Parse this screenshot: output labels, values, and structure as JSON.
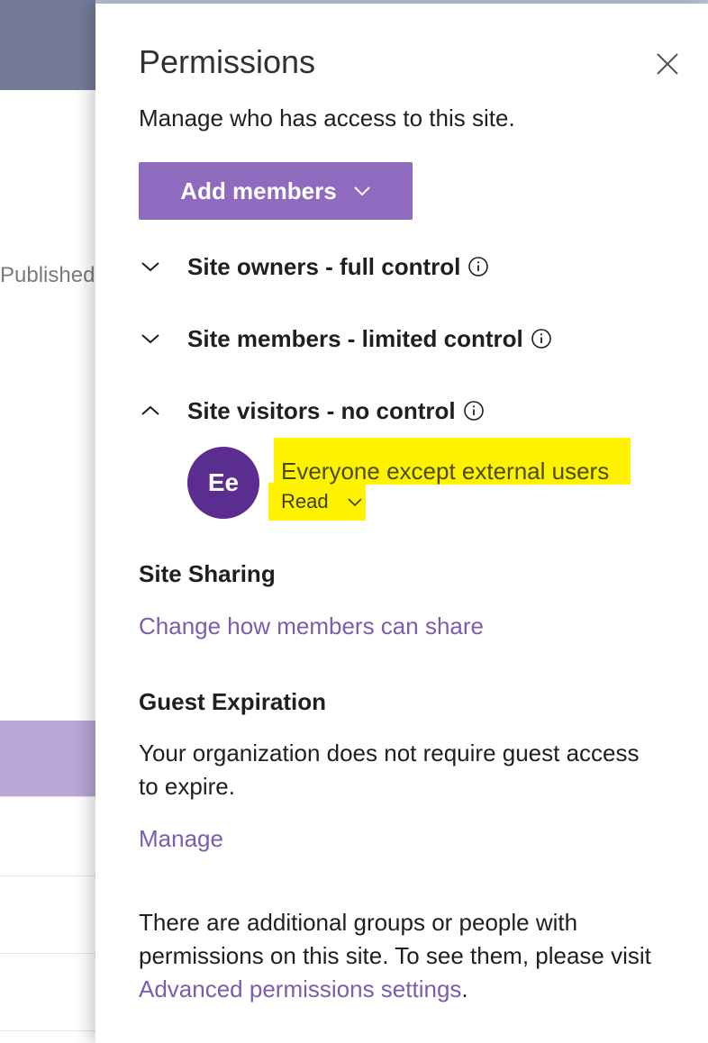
{
  "background": {
    "published_label": "Published"
  },
  "panel": {
    "title": "Permissions",
    "subtitle": "Manage who has access to this site.",
    "add_members_label": "Add members",
    "groups": [
      {
        "label": "Site owners - full control",
        "expanded": false
      },
      {
        "label": "Site members - limited control",
        "expanded": false
      },
      {
        "label": "Site visitors - no control",
        "expanded": true
      }
    ],
    "visitor_member": {
      "initials": "Ee",
      "name": "Everyone except external users",
      "role": "Read"
    },
    "site_sharing": {
      "heading": "Site Sharing",
      "link": "Change how members can share"
    },
    "guest_expiration": {
      "heading": "Guest Expiration",
      "text": "Your organization does not require guest access to expire.",
      "link": "Manage"
    },
    "footer": {
      "text": "There are additional groups or people with permissions on this site. To see them, please visit",
      "link": "Advanced permissions settings",
      "suffix": "."
    }
  },
  "colors": {
    "accent": "#8f6bbf",
    "link": "#7b5cae",
    "avatar": "#5c2d91",
    "highlight": "#fff200"
  },
  "icons": [
    "close-icon",
    "chevron-down-icon",
    "chevron-up-icon",
    "info-icon"
  ]
}
